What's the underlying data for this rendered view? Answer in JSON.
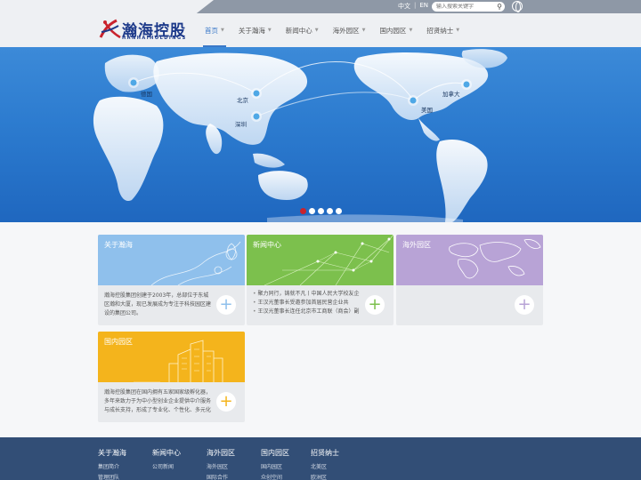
{
  "topbar": {
    "lang_cn": "中文",
    "lang_sep": "|",
    "lang_en": "EN",
    "search_placeholder": "输入搜索关键字"
  },
  "brand": {
    "name_cn": "瀚海控股",
    "name_en": "HANHAIHOLDINGS",
    "color": "#1d3a8a",
    "accent": "#c9232d"
  },
  "nav": [
    {
      "label": "首页",
      "active": true
    },
    {
      "label": "关于瀚海"
    },
    {
      "label": "新闻中心"
    },
    {
      "label": "海外园区"
    },
    {
      "label": "国内园区"
    },
    {
      "label": "招贤纳士"
    }
  ],
  "banner": {
    "locations": [
      "德国",
      "北京",
      "深圳",
      "美国",
      "加拿大"
    ],
    "slides": 5,
    "active_slide": 1
  },
  "cards": {
    "about": {
      "title": "关于瀚海",
      "text": "瀚海控股集团创建于2003年，总部位于东城区瀚和大厦，现已发展成为专注于科技园区建设的集团公司。",
      "color": "#8fc0ec"
    },
    "news": {
      "title": "新闻中心",
      "items": [
        "聚力同行，铸就不凡丨中国人民大学校友企",
        "王汉光董事长受邀参加首届民营企业共",
        "王汉光董事长连任北京市工商联（商会）副"
      ],
      "color": "#7cc04d"
    },
    "overseas": {
      "title": "海外园区",
      "color": "#b8a3d6"
    },
    "domestic": {
      "title": "国内园区",
      "text": "瀚海控股集团在国内拥有五家国家级孵化器，多年来致力于为中小型创业企业提供中介服务与成长支持，形成了专业化、个性化、多元化",
      "color": "#f4b41c"
    }
  },
  "footer": [
    {
      "title": "关于瀚海",
      "links": [
        "集团简介",
        "管理团队"
      ]
    },
    {
      "title": "新闻中心",
      "links": [
        "公司新闻"
      ]
    },
    {
      "title": "海外园区",
      "links": [
        "海外园区",
        "国际合作"
      ]
    },
    {
      "title": "国内园区",
      "links": [
        "国内园区",
        "众创空间"
      ]
    },
    {
      "title": "招贤纳士",
      "links": [
        "北美区",
        "欧洲区"
      ]
    }
  ]
}
